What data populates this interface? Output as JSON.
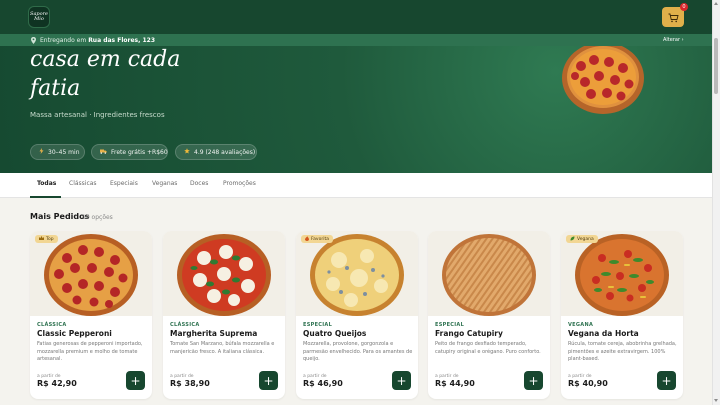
{
  "header": {
    "logo_text": "Sapore Mio",
    "cart_count": "0",
    "delivery_prefix": "Entregando em",
    "delivery_address": "Rua das Flores, 123",
    "change_label": "Alterar ›"
  },
  "hero": {
    "title_line1": "casa em cada",
    "title_line2": "fatia",
    "subtitle": "Massa artesanal · Ingredientes frescos",
    "pills": [
      {
        "icon": "lightning-icon",
        "label": "30–45 min"
      },
      {
        "icon": "truck-icon",
        "label": "Frete grátis +R$60"
      },
      {
        "icon": "star-icon",
        "label": "4.9 (248 avaliações)"
      }
    ]
  },
  "tabs": [
    "Todas",
    "Clássicas",
    "Especiais",
    "Veganas",
    "Doces",
    "Promoções"
  ],
  "section": {
    "title": "Mais Pedidos",
    "count": "10 opções"
  },
  "products": [
    {
      "badge": "Top",
      "category": "CLÁSSICA",
      "name": "Classic Pepperoni",
      "description": "Fatias generosas de pepperoni importado, mozzarella premium e molho de tomate artesanal.",
      "from_label": "a partir de",
      "price": "R$ 42,90"
    },
    {
      "badge": "",
      "category": "CLÁSSICA",
      "name": "Margherita Suprema",
      "description": "Tomate San Marzano, búfala mozzarella e manjericão fresco. A italiana clássica.",
      "from_label": "a partir de",
      "price": "R$ 38,90"
    },
    {
      "badge": "Favorita",
      "category": "ESPECIAL",
      "name": "Quatro Queijos",
      "description": "Mozzarella, provolone, gorgonzola e parmesão envelhecido. Para os amantes de queijo.",
      "from_label": "a partir de",
      "price": "R$ 46,90"
    },
    {
      "badge": "",
      "category": "ESPECIAL",
      "name": "Frango Catupiry",
      "description": "Peito de frango desfiado temperado, catupiry original e orégano. Puro conforto.",
      "from_label": "a partir de",
      "price": "R$ 44,90"
    },
    {
      "badge": "Vegana",
      "category": "VEGANA",
      "name": "Vegana da Horta",
      "description": "Rúcula, tomate cereja, abobrinha grelhada, pimentões e azeite extravirgem. 100% plant-based.",
      "from_label": "a partir de",
      "price": "R$ 40,90"
    }
  ],
  "colors": {
    "primary": "#17472f",
    "accent": "#e0b04a",
    "badge_bg": "#f2d693",
    "category": "#2e7250"
  }
}
